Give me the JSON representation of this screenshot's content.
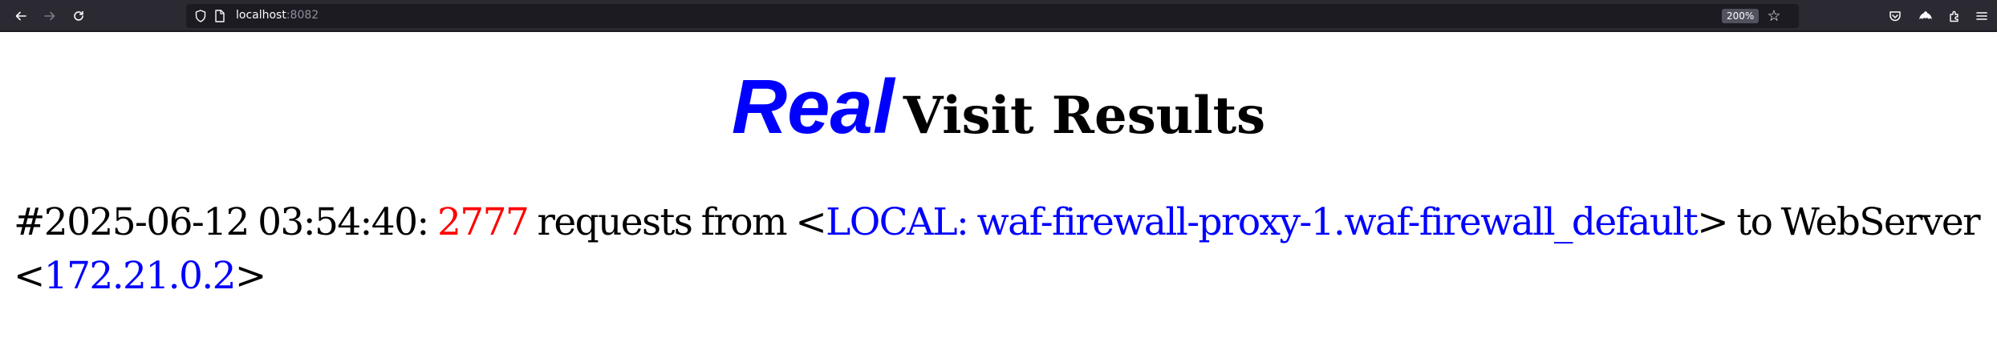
{
  "browser": {
    "url_host": "localhost",
    "url_port": ":8082",
    "zoom": "200%",
    "icons": [
      "back-arrow-icon",
      "forward-arrow-icon",
      "reload-icon",
      "shield-icon",
      "page-icon",
      "star-icon",
      "pocket-icon",
      "account-icon",
      "extensions-icon",
      "menu-icon"
    ]
  },
  "page": {
    "heading": {
      "emphasis": "Real",
      "rest": "Visit Results"
    },
    "result": {
      "prefix": "#2025-06-12 03:54:40: ",
      "count": "2777",
      "middle": " requests from <",
      "source": "LOCAL: waf-firewall-proxy-1.waf-firewall_default",
      "to_text": "> to WebServer <",
      "target": "172.21.0.2",
      "suffix": ">"
    }
  },
  "colors": {
    "link": "#0000ff",
    "count": "#ff0000",
    "heading_emphasis": "#0000ff",
    "toolbar_bg": "#2b2a33",
    "urlbar_bg": "#1c1b22"
  }
}
